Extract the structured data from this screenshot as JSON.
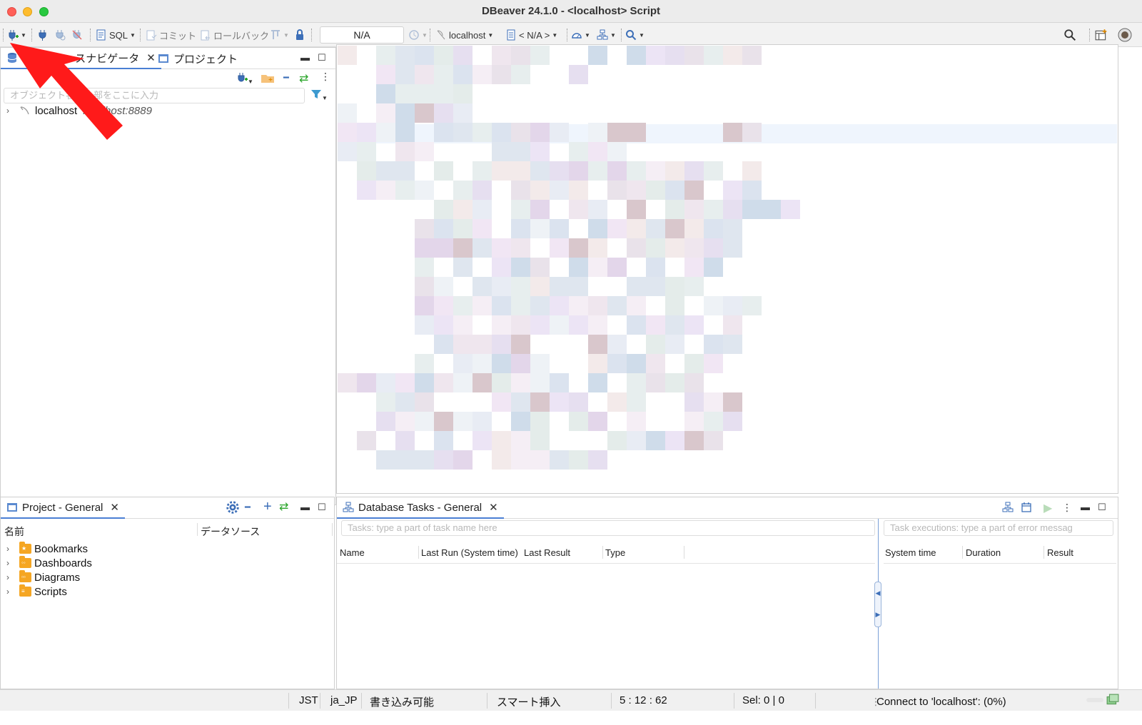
{
  "window": {
    "title": "DBeaver 24.1.0 - <localhost> Script"
  },
  "toolbar": {
    "new_connection_icon": "plug-plus-icon",
    "sql_label": "SQL",
    "commit_label": "コミット",
    "rollback_label": "ロールバック",
    "transaction_mode_value": "N/A",
    "connection_selector": "localhost",
    "schema_selector": "< N/A >"
  },
  "navigator": {
    "tab_db_label": "データベースナビゲータ",
    "tab_project_label": "プロジェクト",
    "filter_placeholder": "オブジェクト名の一部をここに入力",
    "connection_name": "localhost",
    "connection_host": "localhost:8889"
  },
  "project_panel": {
    "tab_label": "Project - General",
    "col_name": "名前",
    "col_datasource": "データソース",
    "items": [
      {
        "label": "Bookmarks"
      },
      {
        "label": "Dashboards"
      },
      {
        "label": "Diagrams"
      },
      {
        "label": "Scripts"
      }
    ]
  },
  "tasks_panel": {
    "tab_label": "Database Tasks - General",
    "task_filter_placeholder": "Tasks: type a part of task name here",
    "exec_filter_placeholder": "Task executions: type a part of error messag",
    "task_columns": [
      "Name",
      "Last Run (System time)",
      "Last Result",
      "Type"
    ],
    "exec_columns": [
      "System time",
      "Duration",
      "Result"
    ]
  },
  "statusbar": {
    "timezone": "JST",
    "locale": "ja_JP",
    "write_mode": "書き込み可能",
    "insert_mode": "スマート挿入",
    "cursor_pos": "5 : 12 : 62",
    "selection": "Sel: 0 | 0",
    "connect_status": "Connect to 'localhost': (0%)"
  },
  "colors": {
    "accent": "#4a7fd4",
    "annotation_arrow": "#ff1a1a",
    "folder": "#f5a623"
  }
}
